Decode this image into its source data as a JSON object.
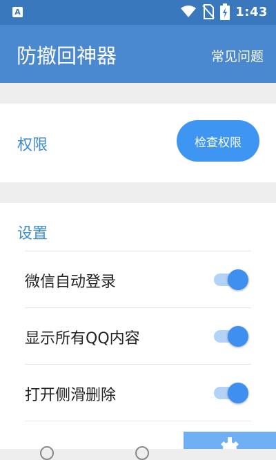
{
  "status_bar": {
    "time": "1:43",
    "icons": [
      "app-badge-icon",
      "wifi-icon",
      "no-sim-icon",
      "battery-charging-icon"
    ]
  },
  "app_bar": {
    "title": "防撤回神器",
    "faq_label": "常见问题"
  },
  "permissions": {
    "title": "权限",
    "check_button": "检查权限"
  },
  "settings": {
    "title": "设置",
    "items": [
      {
        "label": "微信自动登录",
        "enabled": true
      },
      {
        "label": "显示所有QQ内容",
        "enabled": true
      },
      {
        "label": "打开侧滑删除",
        "enabled": true
      }
    ]
  },
  "colors": {
    "app_bar": "#4a88cf",
    "status_bar": "#3a78bd",
    "accent": "#3e96f2",
    "section_title": "#3f8ccf"
  }
}
